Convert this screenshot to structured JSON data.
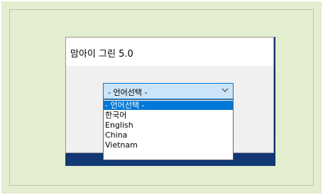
{
  "dialog": {
    "title": "맘아이 그린 5.0"
  },
  "language_select": {
    "value": "- 언어선택 -",
    "arrow_icon": "chevron-down-icon",
    "options": [
      {
        "label": "- 언어선택 -",
        "selected": true
      },
      {
        "label": "한국어",
        "selected": false
      },
      {
        "label": "English",
        "selected": false
      },
      {
        "label": "China",
        "selected": false
      },
      {
        "label": "Vietnam",
        "selected": false
      }
    ]
  },
  "colors": {
    "frame_background": "#e3edcf",
    "selection": "#0078d7",
    "select_background": "#cce4f7",
    "wallpaper": "#123876"
  }
}
